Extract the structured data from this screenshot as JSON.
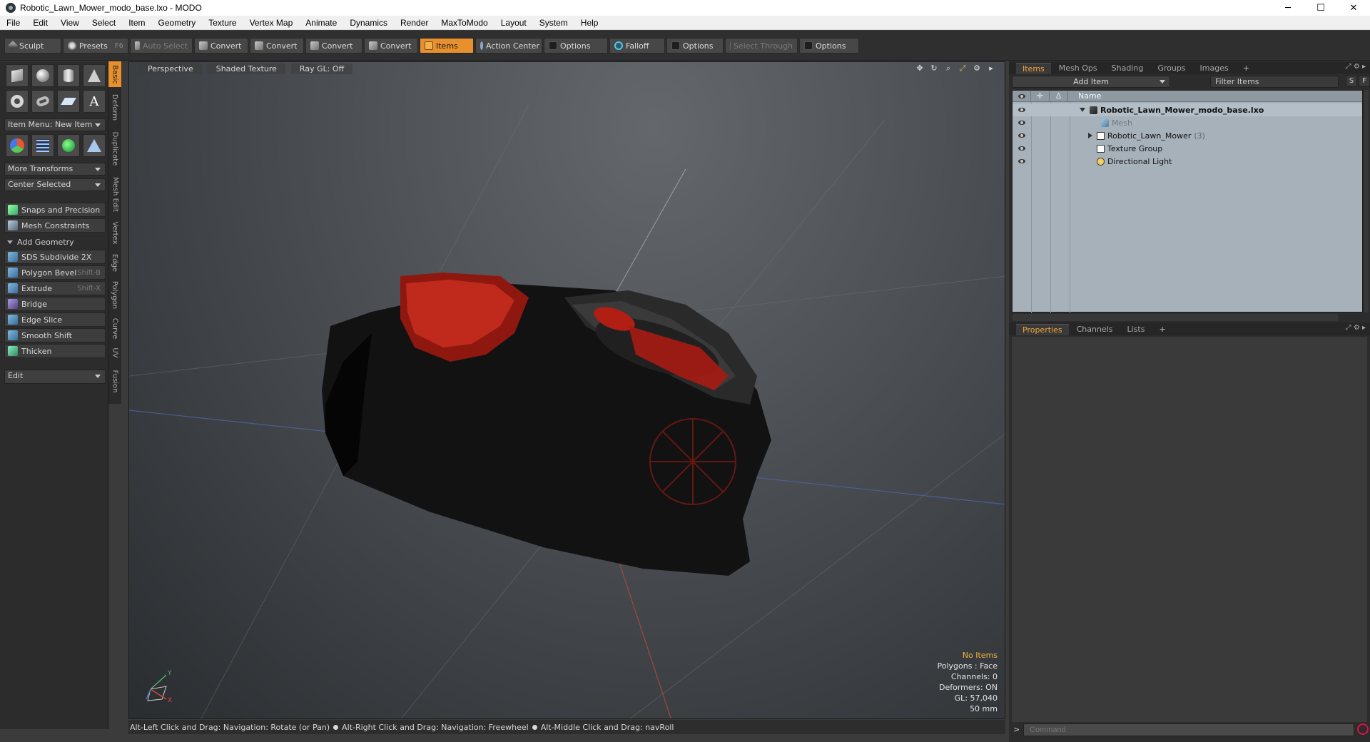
{
  "window": {
    "title": "Robotic_Lawn_Mower_modo_base.lxo - MODO",
    "controls": [
      "─",
      "☐",
      "✕"
    ]
  },
  "menubar": [
    "File",
    "Edit",
    "View",
    "Select",
    "Item",
    "Geometry",
    "Texture",
    "Vertex Map",
    "Animate",
    "Dynamics",
    "Render",
    "MaxToModo",
    "Layout",
    "System",
    "Help"
  ],
  "toolbar": {
    "sculpt": "Sculpt",
    "presets": "Presets",
    "presets_key": "F6",
    "auto_select": "Auto Select",
    "convert1": "Convert",
    "convert2": "Convert",
    "convert3": "Convert",
    "convert4": "Convert",
    "items": "Items",
    "action_center": "Action Center",
    "options1": "Options",
    "falloff": "Falloff",
    "options2": "Options",
    "select_through": "Select Through",
    "options3": "Options"
  },
  "toolbox": {
    "item_menu": "Item Menu: New Item",
    "more_transforms": "More Transforms",
    "center_selected": "Center Selected",
    "snaps": "Snaps and Precision",
    "mesh_constraints": "Mesh Constraints",
    "add_geometry": "Add Geometry",
    "tools": [
      {
        "label": "SDS Subdivide 2X",
        "key": ""
      },
      {
        "label": "Polygon Bevel",
        "key": "Shift-B"
      },
      {
        "label": "Extrude",
        "key": "Shift-X"
      },
      {
        "label": "Bridge",
        "key": ""
      },
      {
        "label": "Edge Slice",
        "key": ""
      },
      {
        "label": "Smooth Shift",
        "key": ""
      },
      {
        "label": "Thicken",
        "key": ""
      }
    ],
    "edit": "Edit"
  },
  "vtabs": [
    "Basic",
    "Deform",
    "Duplicate",
    "Mesh Edit",
    "Vertex",
    "Edge",
    "Polygon",
    "Curve",
    "UV",
    "Fusion"
  ],
  "viewport": {
    "perspective": "Perspective",
    "shading": "Shaded Texture",
    "raygl": "Ray GL: Off",
    "hud": {
      "no_items": "No Items",
      "polygons": "Polygons : Face",
      "channels": "Channels: 0",
      "deformers": "Deformers: ON",
      "gl": "GL: 57,040",
      "scale": "50 mm"
    },
    "axis_y": "Y",
    "axis_x": "X"
  },
  "statusbar": {
    "hint1": "Alt-Left Click and Drag: Navigation: Rotate (or Pan)",
    "hint2": "Alt-Right Click and Drag: Navigation: Freewheel",
    "hint3": "Alt-Middle Click and Drag: navRoll"
  },
  "items_panel": {
    "tabs": [
      "Items",
      "Mesh Ops",
      "Shading",
      "Groups",
      "Images",
      "+"
    ],
    "add_item": "Add Item",
    "filter": "Filter Items",
    "s_btn": "S",
    "f_btn": "F",
    "col_name": "Name",
    "rows": [
      {
        "name": "Robotic_Lawn_Mower_modo_base.lxo",
        "count": ""
      },
      {
        "name": "Mesh",
        "count": ""
      },
      {
        "name": "Robotic_Lawn_Mower",
        "count": "(3)"
      },
      {
        "name": "Texture Group",
        "count": ""
      },
      {
        "name": "Directional Light",
        "count": ""
      }
    ]
  },
  "props_panel": {
    "tabs": [
      "Properties",
      "Channels",
      "Lists",
      "+"
    ]
  },
  "command": {
    "placeholder": "Command",
    "arrow": ">"
  },
  "colors": {
    "accent": "#e7902d",
    "list_bg": "#a7b1b9",
    "hud_warning": "#f5b53c"
  }
}
